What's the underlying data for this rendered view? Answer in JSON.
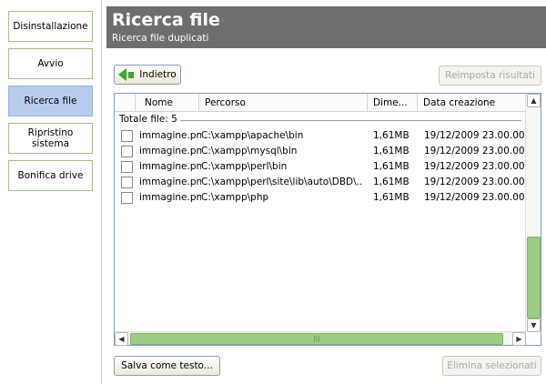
{
  "sidebar": {
    "items": [
      {
        "label": "Disinstallazione"
      },
      {
        "label": "Avvio"
      },
      {
        "label": "Ricerca file"
      },
      {
        "label": "Ripristino sistema"
      },
      {
        "label": "Bonifica drive"
      }
    ],
    "active_index": 2
  },
  "header": {
    "title": "Ricerca file",
    "subtitle": "Ricerca file duplicati"
  },
  "toolbar": {
    "back_label": "Indietro",
    "reset_label": "Reimposta risultati"
  },
  "list": {
    "columns": [
      "Nome",
      "Percorso",
      "Dime...",
      "Data creazione"
    ],
    "group_label": "Totale file: 5",
    "rows": [
      {
        "name": "immagine.png",
        "path": "C:\\xampp\\apache\\bin",
        "size": "1,61MB",
        "date": "19/12/2009 23.00.00"
      },
      {
        "name": "immagine.png",
        "path": "C:\\xampp\\mysql\\bin",
        "size": "1,61MB",
        "date": "19/12/2009 23.00.00"
      },
      {
        "name": "immagine.png",
        "path": "C:\\xampp\\perl\\bin",
        "size": "1,61MB",
        "date": "19/12/2009 23.00.00"
      },
      {
        "name": "immagine.png",
        "path": "C:\\xampp\\perl\\site\\lib\\auto\\DBD\\...",
        "size": "1,61MB",
        "date": "19/12/2009 23.00.00"
      },
      {
        "name": "immagine.png",
        "path": "C:\\xampp\\php",
        "size": "1,61MB",
        "date": "19/12/2009 23.00.00"
      }
    ]
  },
  "footer": {
    "save_label": "Salva come testo...",
    "delete_label": "Elimina selezionati"
  },
  "colors": {
    "header_bg": "#6e6e6e",
    "active_nav": "#b8cdee",
    "scroll_thumb": "#9ccd84",
    "back_arrow": "#3fa336"
  }
}
